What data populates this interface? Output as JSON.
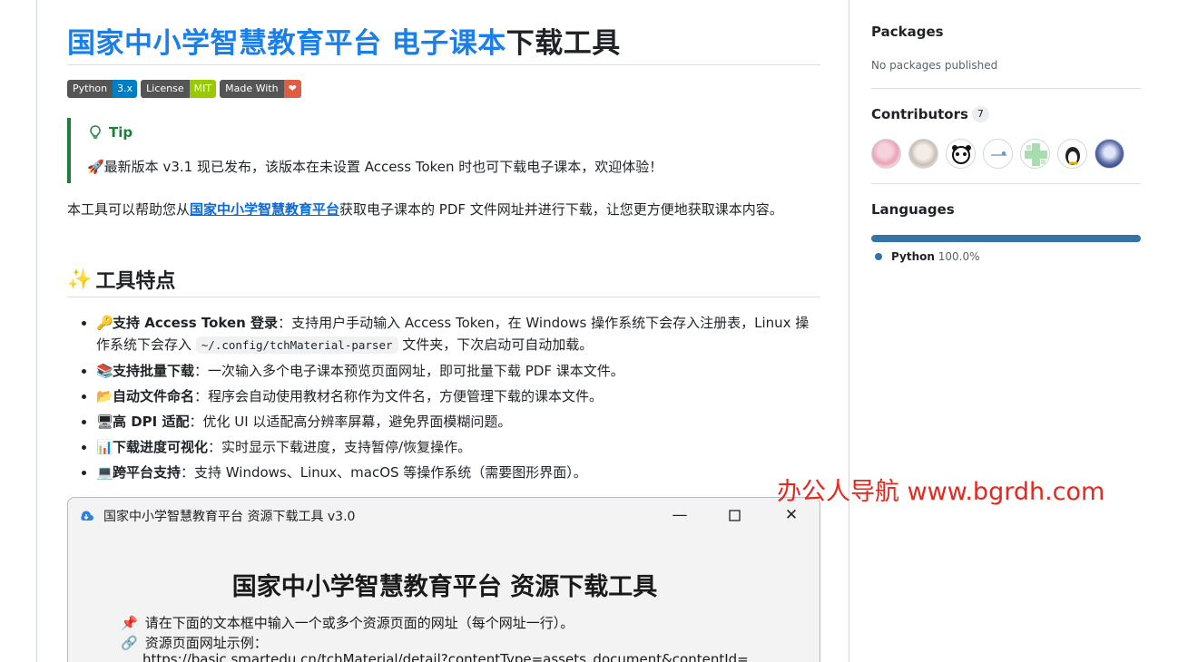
{
  "readme": {
    "title_blue": "国家中小学智慧教育平台 电子课本",
    "title_black": "下载工具",
    "badges": [
      {
        "left": "Python",
        "right": "3.x",
        "color": "#007ec6"
      },
      {
        "left": "License",
        "right": "MIT",
        "color": "#97ca00"
      },
      {
        "left": "Made With",
        "right": "❤",
        "color": "#e05d44"
      }
    ],
    "tip": {
      "label": "Tip",
      "text": "🚀最新版本 v3.1 现已发布，该版本在未设置 Access Token 时也可下载电子课本，欢迎体验！"
    },
    "intro": {
      "before": "本工具可以帮助您从",
      "link": "国家中小学智慧教育平台",
      "after": "获取电子课本的 PDF 文件网址并进行下载，让您更方便地获取课本内容。"
    },
    "features_heading": "工具特点",
    "features": [
      {
        "emoji": "🔑",
        "title": "支持 Access Token 登录",
        "text": "：支持用户手动输入 Access Token，在 Windows 操作系统下会存入注册表，Linux 操作系统下会存入 ",
        "code": "~/.config/tchMaterial-parser",
        "after": " 文件夹，下次启动可自动加载。"
      },
      {
        "emoji": "📚",
        "title": "支持批量下载",
        "text": "：一次输入多个电子课本预览页面网址，即可批量下载 PDF 课本文件。"
      },
      {
        "emoji": "📂",
        "title": "自动文件命名",
        "text": "：程序会自动使用教材名称作为文件名，方便管理下载的课本文件。"
      },
      {
        "emoji": "🖥",
        "title": "高 DPI 适配",
        "text": "：优化 UI 以适配高分辨率屏幕，避免界面模糊问题。"
      },
      {
        "emoji": "📊",
        "title": "下载进度可视化",
        "text": "：实时显示下载进度，支持暂停/恢复操作。"
      },
      {
        "emoji": "💻",
        "title": "跨平台支持",
        "text": "：支持 Windows、Linux、macOS 等操作系统（需要图形界面）。"
      }
    ],
    "screenshot_window": {
      "title": "国家中小学智慧教育平台 资源下载工具 v3.0",
      "heading": "国家中小学智慧教育平台 资源下载工具",
      "line1": "请在下面的文本框中输入一个或多个资源页面的网址（每个网址一行）。",
      "line2": "资源页面网址示例：",
      "line3": "https://basic.smartedu.cn/tchMaterial/detail?contentType=assets_document&contentId="
    }
  },
  "watermark": "办公人导航  www.bgrdh.com",
  "sidebar": {
    "packages_heading": "Packages",
    "packages_text": "No packages published",
    "contributors_heading": "Contributors",
    "contributors_count": "7",
    "languages_heading": "Languages",
    "language_name": "Python",
    "language_pct": "100.0%",
    "language_color": "#3572a5"
  }
}
